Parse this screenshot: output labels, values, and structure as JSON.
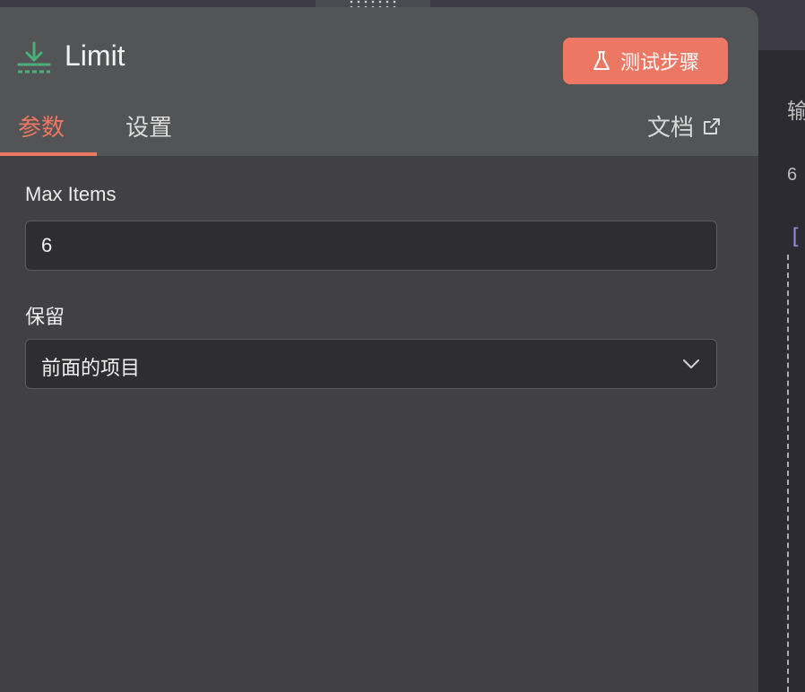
{
  "node": {
    "title": "Limit",
    "icon": "download-limit-icon",
    "icon_color": "#4caf7a"
  },
  "toolbar": {
    "test_step_label": "测试步骤",
    "test_step_icon": "flask-icon",
    "accent_color": "#ec7763"
  },
  "tabs": [
    {
      "label": "参数",
      "active": true
    },
    {
      "label": "设置",
      "active": false
    }
  ],
  "docs": {
    "label": "文档",
    "icon": "external-link-icon"
  },
  "fields": {
    "max_items": {
      "label": "Max Items",
      "value": "6"
    },
    "keep": {
      "label": "保留",
      "selected": "前面的项目"
    }
  },
  "output_panel": {
    "heading": "输",
    "count": "6",
    "bracket": "["
  }
}
